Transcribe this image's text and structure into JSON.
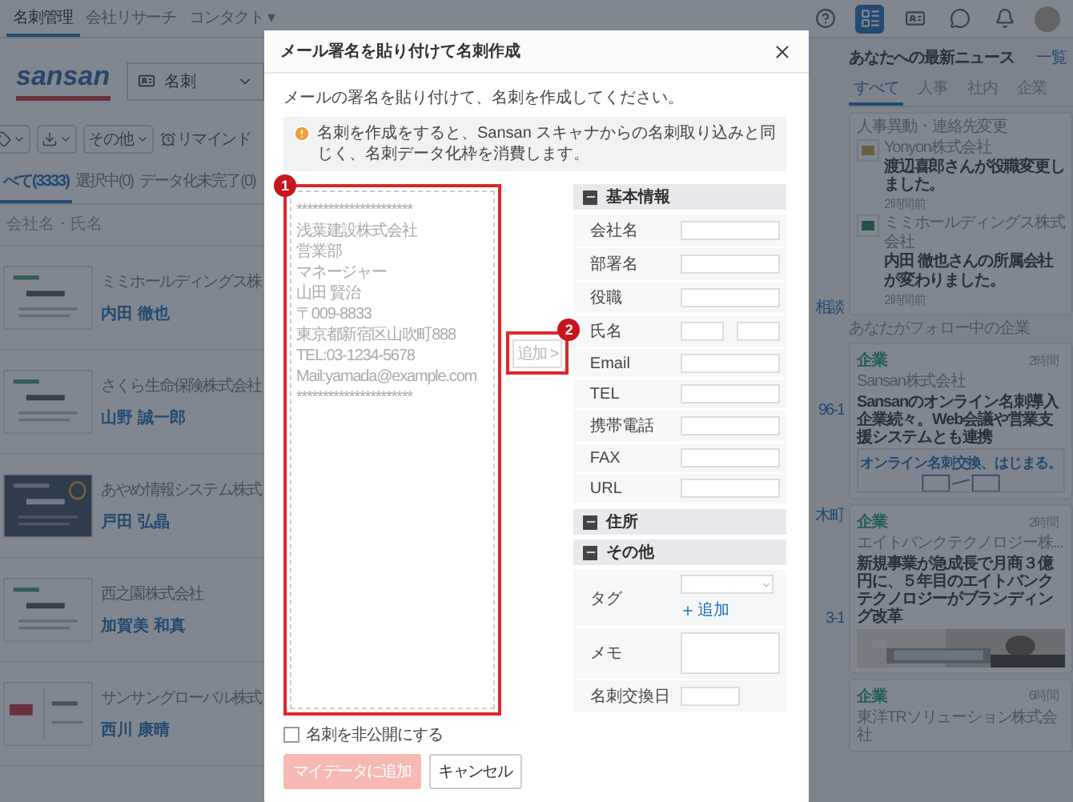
{
  "nav": {
    "tabs": [
      {
        "label": "名刺管理",
        "selected": true
      },
      {
        "label": "会社リサーチ",
        "selected": false
      },
      {
        "label": "コンタクト ▾",
        "selected": false
      }
    ],
    "icons": [
      {
        "selected": false
      },
      {
        "selected": true
      },
      {
        "selected": false
      },
      {
        "selected": false
      },
      {
        "selected": false
      },
      {
        "selected": false
      }
    ]
  },
  "logo": "sansan",
  "type_select": "名刺",
  "toolbar": {
    "more": "その他",
    "remind": "リマインド"
  },
  "list_tabs": [
    {
      "label": "べて(3333)",
      "selected": true
    },
    {
      "label": "選択中(0)",
      "selected": false
    },
    {
      "label": "データ化未完了(0)",
      "selected": false
    }
  ],
  "search": {
    "placeholder": "会社名・氏名"
  },
  "cards": [
    {
      "company": "ミミホールディングス株",
      "name": "内田 徹也",
      "kind": "plain",
      "side_text": "相談"
    },
    {
      "company": "さくら生命保険株式会社",
      "name": "山野 誠一郎",
      "kind": "plain",
      "side_text": "96-1"
    },
    {
      "company": "あやめ情報システム株式",
      "name": "戸田 弘晶",
      "kind": "dark",
      "side_text": "木町"
    },
    {
      "company": "西之園株式会社",
      "name": "加賀美 和真",
      "kind": "plain",
      "side_text": "3-1"
    },
    {
      "company": "サンサングローバル株式",
      "name": "西川 康晴",
      "kind": "logo"
    }
  ],
  "news": {
    "title": "あなたへの最新ニュース",
    "more": "一覧",
    "tabs": [
      {
        "label": "すべて",
        "selected": true
      },
      {
        "label": "人事",
        "selected": false
      },
      {
        "label": "社内",
        "selected": false
      },
      {
        "label": "企業",
        "selected": false
      }
    ],
    "updates": {
      "heading": "人事異動・連絡先変更",
      "items": [
        {
          "company": "Yonyon株式会社",
          "text": "渡辺喜郎さんが役職変更しました。",
          "time": "2時間前"
        },
        {
          "company": "ミミホールディングス株式会社",
          "text": "内田 徹也さんの所属会社が変わりました。",
          "time": "2時間前"
        }
      ]
    },
    "follow_heading": "あなたがフォロー中の企業",
    "articles": [
      {
        "tag": "企業",
        "time": "2時間",
        "company": "Sansan株式会社",
        "title": "Sansanのオンライン名刺導入企業続々。Web会議や営業支援システムとも連携",
        "kind": "banner",
        "banner": "オンライン名刺交換、はじまる。"
      },
      {
        "tag": "企業",
        "time": "2時間",
        "company": "エイトバンクテクノロジー株...",
        "title": "新規事業が急成長で月商３億円に、５年目のエイトバンクテクノロジーがブランディング改革",
        "kind": "picture"
      },
      {
        "tag": "企業",
        "time": "6時間",
        "company": "東洋TRソリューション株式会社",
        "kind": "text"
      }
    ]
  },
  "dialog": {
    "title": "メール署名を貼り付けて名刺作成",
    "intro": "メールの署名を貼り付けて、名刺を作成してください。",
    "notice": "名刺を作成をすると、Sansan スキャナからの名刺取り込みと同じく、名刺データ化枠を消費します。",
    "signature_placeholder": [
      "**********************",
      "浅葉建設株式会社",
      "営業部",
      "マネージャー",
      "山田 賢治",
      "〒009-8833",
      "東京都新宿区山吹町888",
      "TEL:03-1234-5678",
      "Mail:yamada@example.com",
      "**********************"
    ],
    "add_button": {
      "label": "追加 >",
      "disabled": true
    },
    "markers": [
      "1",
      "2"
    ],
    "sections": [
      {
        "title": "基本情報",
        "expanded": true,
        "fields": [
          {
            "label": "会社名",
            "kind": "text"
          },
          {
            "label": "部署名",
            "kind": "text"
          },
          {
            "label": "役職",
            "kind": "text"
          },
          {
            "label": "氏名",
            "kind": "split"
          },
          {
            "label": "Email",
            "kind": "text"
          },
          {
            "label": "TEL",
            "kind": "text"
          },
          {
            "label": "携帯電話",
            "kind": "text"
          },
          {
            "label": "FAX",
            "kind": "text"
          },
          {
            "label": "URL",
            "kind": "text"
          }
        ]
      },
      {
        "title": "住所",
        "expanded": true
      },
      {
        "title": "その他",
        "expanded": true,
        "fields": [
          {
            "label": "タグ",
            "kind": "tags",
            "add_label": "追加"
          },
          {
            "label": "メモ",
            "kind": "memo"
          },
          {
            "label": "名刺交換日",
            "kind": "date"
          }
        ]
      }
    ],
    "private": {
      "label": "名刺を非公開にする",
      "checked": false
    },
    "buttons": [
      {
        "label": "マイデータに追加",
        "kind": "primary",
        "disabled": true
      },
      {
        "label": "キャンセル",
        "kind": "secondary",
        "disabled": false
      }
    ]
  }
}
